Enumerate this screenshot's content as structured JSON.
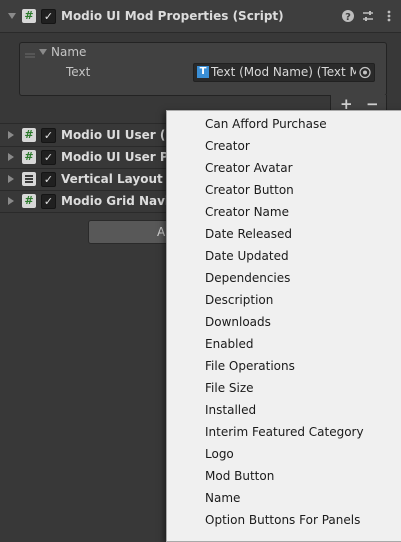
{
  "component": {
    "title": "Modio UI Mod Properties (Script)",
    "enabled_check": "✓",
    "icons": {
      "help": "help-icon",
      "settings": "settings-icon",
      "more": "more-icon"
    }
  },
  "name_list": {
    "header": "Name",
    "field_label": "Text",
    "field_value": "Text (Mod Name) (Text Mesh",
    "add_label": "+",
    "remove_label": "−"
  },
  "components": [
    {
      "title": "Modio UI User (Sc",
      "icon": "script-icon"
    },
    {
      "title": "Modio UI User Pro",
      "icon": "script-icon"
    },
    {
      "title": "Vertical Layout Gr",
      "icon": "layout-icon"
    },
    {
      "title": "Modio Grid Naviga",
      "icon": "script-icon"
    }
  ],
  "add_component_partial": "A",
  "dropdown": {
    "items": [
      "Can Afford Purchase",
      "Creator",
      "Creator Avatar",
      "Creator Button",
      "Creator Name",
      "Date Released",
      "Date Updated",
      "Dependencies",
      "Description",
      "Downloads",
      "Enabled",
      "File Operations",
      "File Size",
      "Installed",
      "Interim Featured Category",
      "Logo",
      "Mod Button",
      "Name",
      "Option Buttons For Panels"
    ]
  },
  "colors": {
    "panel_bg": "#383838",
    "header_bg": "#3e3e3e",
    "dropdown_bg": "#f0f0f0",
    "script_icon_green": "#2b7a2b",
    "text_type_blue": "#3a8fd6"
  }
}
